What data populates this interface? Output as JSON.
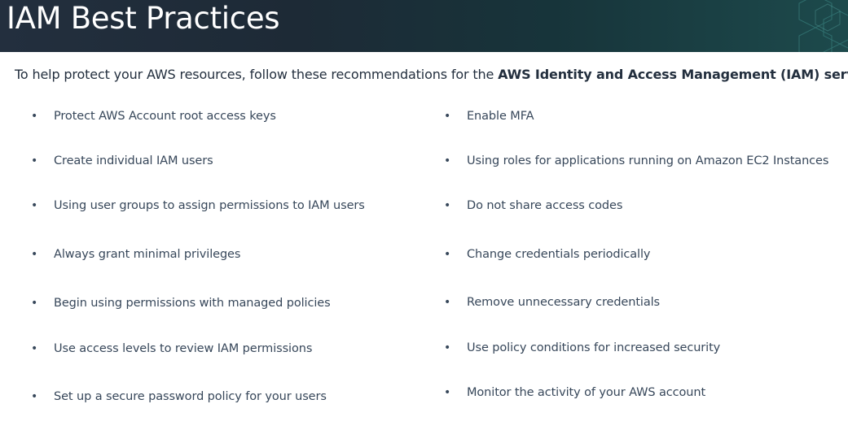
{
  "banner": {
    "title": "IAM Best Practices"
  },
  "intro": {
    "text_before": "To help protect your AWS resources, follow these recommendations for the ",
    "text_bold": "AWS Identity and Access Management (IAM) service."
  },
  "left_items": [
    "Protect AWS Account root access keys",
    "Create individual IAM users",
    "Using user groups to assign permissions to IAM users",
    "Always grant minimal privileges",
    "Begin using permissions with managed policies",
    "Use access levels to review IAM permissions",
    "Set up a secure password policy for your users"
  ],
  "right_items": [
    "Enable MFA",
    "Using roles for applications running on Amazon EC2 Instances",
    "Do not share access codes",
    "Change credentials periodically",
    "Remove unnecessary credentials",
    "Use policy conditions for increased security",
    "Monitor the activity of your AWS account"
  ],
  "bullet_glyph": "•",
  "colors": {
    "banner_bg": "#232f3e",
    "banner_text": "#ffffff",
    "body_text": "#37475a"
  }
}
